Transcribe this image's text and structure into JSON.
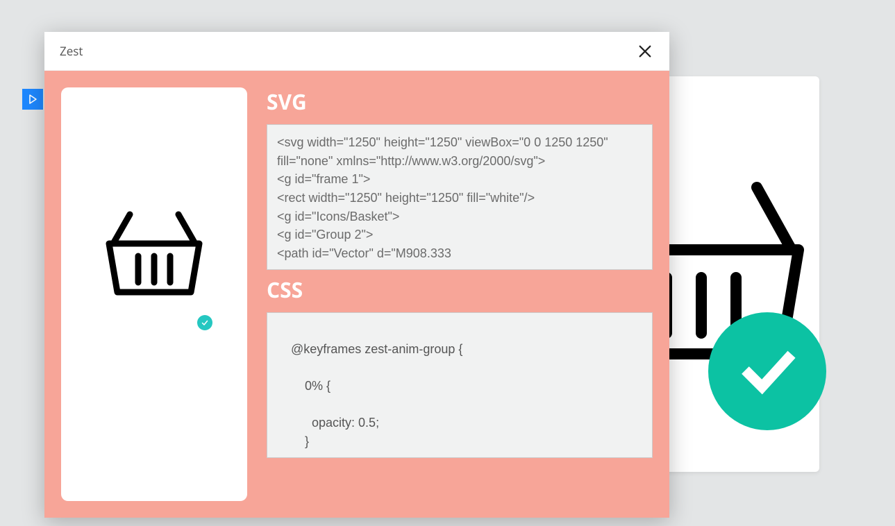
{
  "dialog": {
    "title": "Zest",
    "sections": {
      "svg_label": "SVG",
      "css_label": "CSS"
    },
    "svg_code": "<svg width=\"1250\" height=\"1250\" viewBox=\"0 0 1250 1250\" fill=\"none\" xmlns=\"http://www.w3.org/2000/svg\">\n<g id=\"frame 1\">\n<rect width=\"1250\" height=\"1250\" fill=\"white\"/>\n<g id=\"Icons/Basket\">\n<g id=\"Group 2\">\n<path id=\"Vector\" d=\"M908.333",
    "css_code": "\n    @keyframes zest-anim-group {\n\n        0% {\n\n          opacity: 0.5;\n        }"
  },
  "colors": {
    "accent_teal": "#0cc2a3",
    "panel_pink": "#f7a598",
    "blue": "#1e88ff"
  }
}
